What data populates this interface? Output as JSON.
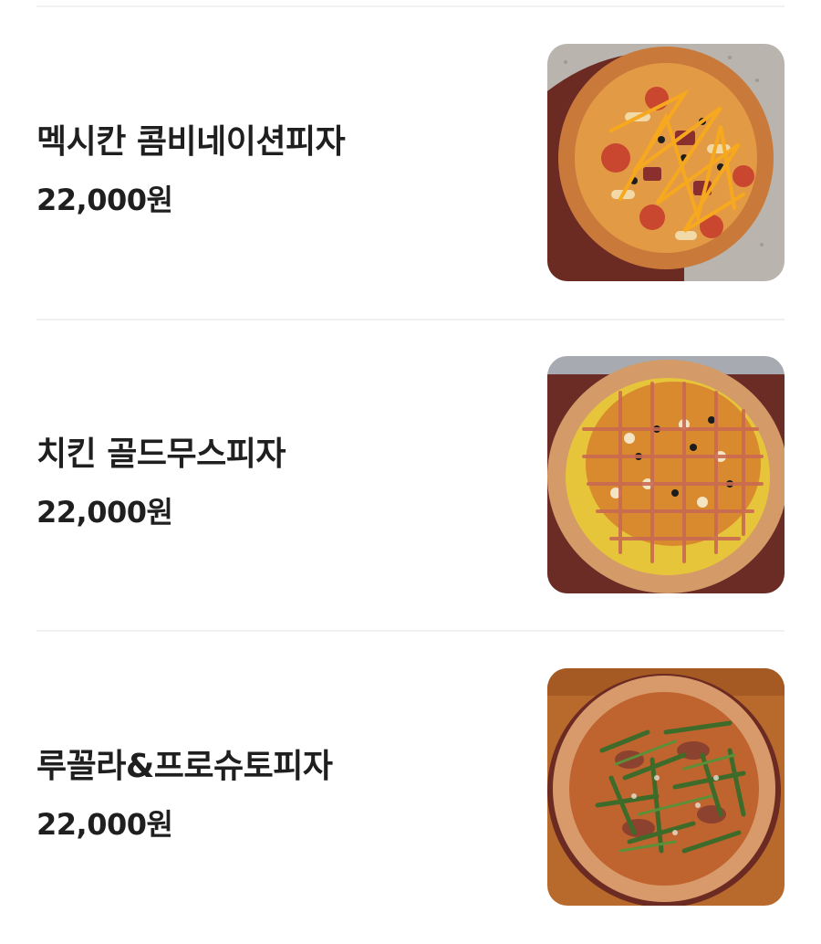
{
  "menu": {
    "items": [
      {
        "name": "멕시칸 콤비네이션피자",
        "price": "22,000원",
        "image_icon": "pizza-photo-mexican-combination"
      },
      {
        "name": "치킨 골드무스피자",
        "price": "22,000원",
        "image_icon": "pizza-photo-chicken-gold-mousse"
      },
      {
        "name": "루꼴라&프로슈토피자",
        "price": "22,000원",
        "image_icon": "pizza-photo-arugula-prosciutto"
      }
    ]
  }
}
